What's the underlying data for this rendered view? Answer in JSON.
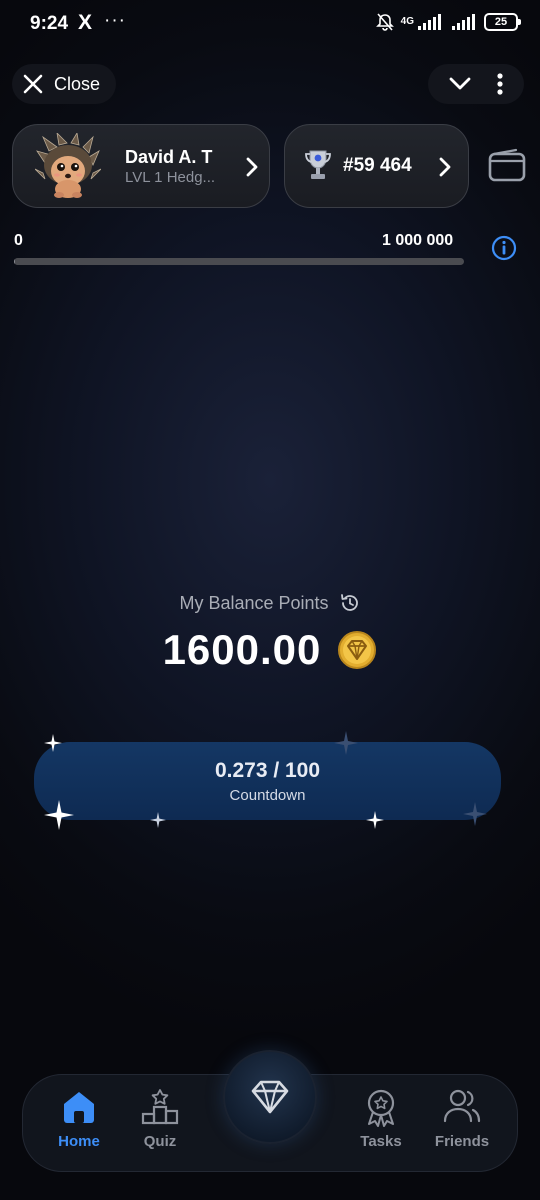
{
  "status_bar": {
    "time": "9:24",
    "x_icon": "X",
    "dots": "···",
    "network": "4G",
    "battery": "25"
  },
  "header": {
    "close_label": "Close"
  },
  "profile": {
    "name": "David A. T",
    "subtitle": "LVL 1 Hedg..."
  },
  "rank": {
    "label": "#59 464"
  },
  "progress": {
    "min_label": "0",
    "max_label": "1 000 000",
    "value_fraction": 0.0016
  },
  "balance": {
    "label": "My Balance Points",
    "value": "1600.00"
  },
  "countdown": {
    "value": "0.273 / 100",
    "label": "Countdown"
  },
  "nav": {
    "items": [
      {
        "label": "Home",
        "icon": "home-icon",
        "active": true
      },
      {
        "label": "Quiz",
        "icon": "podium-icon",
        "active": false
      },
      {
        "label": "Tasks",
        "icon": "badge-icon",
        "active": false
      },
      {
        "label": "Friends",
        "icon": "friends-icon",
        "active": false
      }
    ]
  },
  "colors": {
    "accent": "#3d8ef7",
    "countdown_bg": "#143764",
    "coin": "#f0c040"
  }
}
